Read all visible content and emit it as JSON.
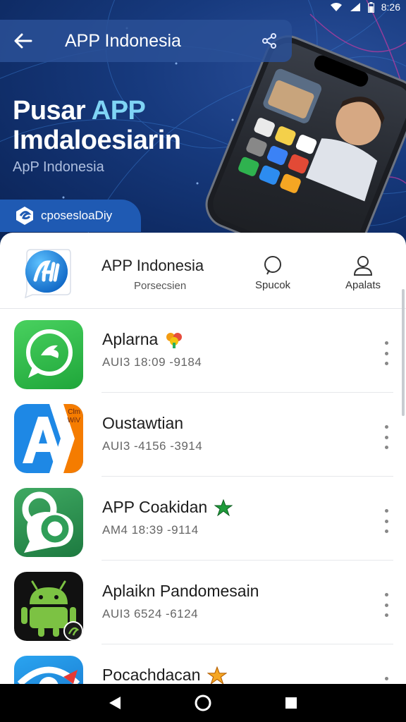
{
  "status_bar": {
    "time": "8:26"
  },
  "hero": {
    "appbar_title": "APP Indonesia",
    "title_line1_plain": "Pusar ",
    "title_line1_accent": "APP",
    "title_line2": "Imdaloesiarin",
    "subtitle": "ApP Indonesia",
    "badge_label": "cposeslоaDiy"
  },
  "header": {
    "app_name": "APP Indonesia",
    "app_sub": "Porsecsien",
    "search_label": "Spucok",
    "profile_label": "Apalats"
  },
  "list": {
    "items": [
      {
        "name": "Aplarna",
        "meta": "AUI3  18:09  -9184",
        "badge_icon": "flower-icon"
      },
      {
        "name": "Oustawtian",
        "meta": "AUI3  -4156  -3914",
        "badge_icon": ""
      },
      {
        "name": "APP Coakidan",
        "meta": "AM4  18:39  -9114",
        "badge_icon": "green-star-icon"
      },
      {
        "name": "Aplaikn Pandomesain",
        "meta": "AUI3  6524  -6124",
        "badge_icon": ""
      },
      {
        "name": "Pocachdacan",
        "meta": "",
        "badge_icon": "orange-star-icon"
      }
    ]
  },
  "icon_texts": {
    "oust_corner": "Clm\nWiV"
  },
  "colors": {
    "accent": "#7fd4f5",
    "hero_bg": "#173a7e",
    "badge_bg": "#1f5ab3",
    "whatsapp_green": "#29b84a",
    "android_green": "#7cc243"
  }
}
